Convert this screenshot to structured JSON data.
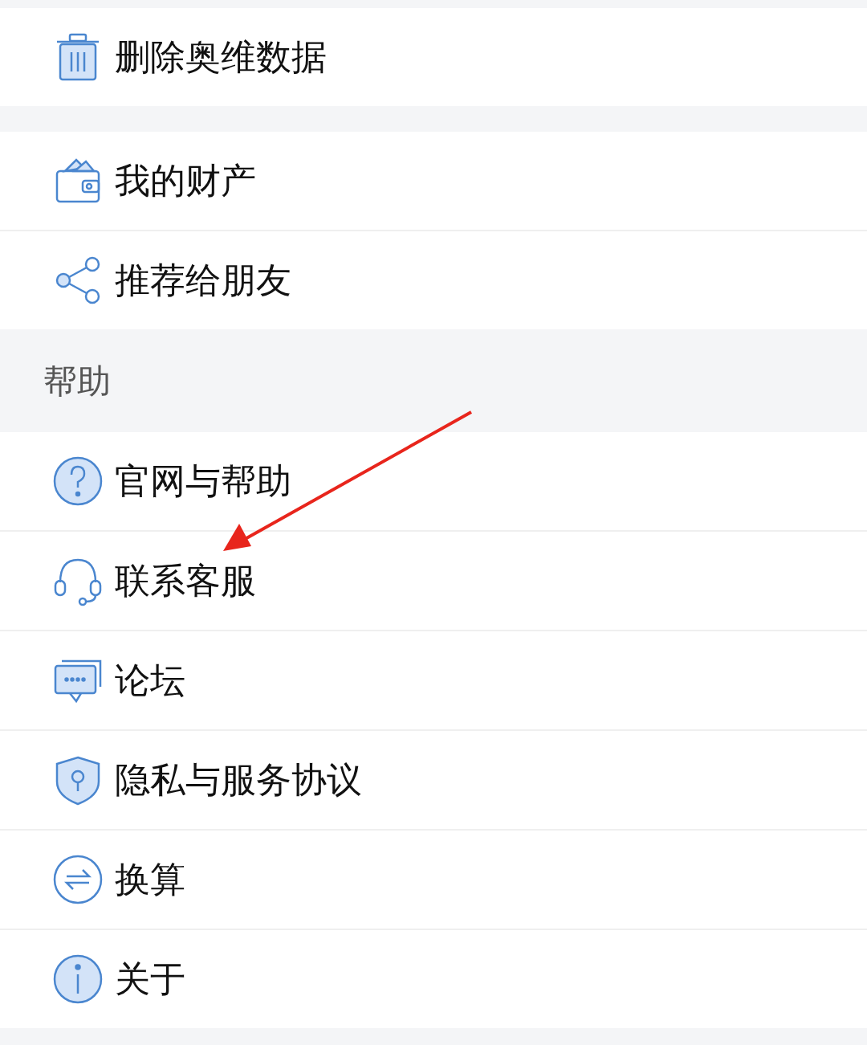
{
  "groups": [
    {
      "items": [
        {
          "kind": "trash",
          "label": "删除奥维数据"
        }
      ]
    },
    {
      "items": [
        {
          "kind": "wallet",
          "label": "我的财产"
        },
        {
          "kind": "share",
          "label": "推荐给朋友"
        }
      ]
    },
    {
      "header": "帮助",
      "items": [
        {
          "kind": "help",
          "label": "官网与帮助"
        },
        {
          "kind": "headset",
          "label": "联系客服"
        },
        {
          "kind": "chat",
          "label": "论坛"
        },
        {
          "kind": "shield",
          "label": "隐私与服务协议"
        },
        {
          "kind": "exchange",
          "label": "换算"
        },
        {
          "kind": "info",
          "label": "关于"
        }
      ]
    }
  ]
}
